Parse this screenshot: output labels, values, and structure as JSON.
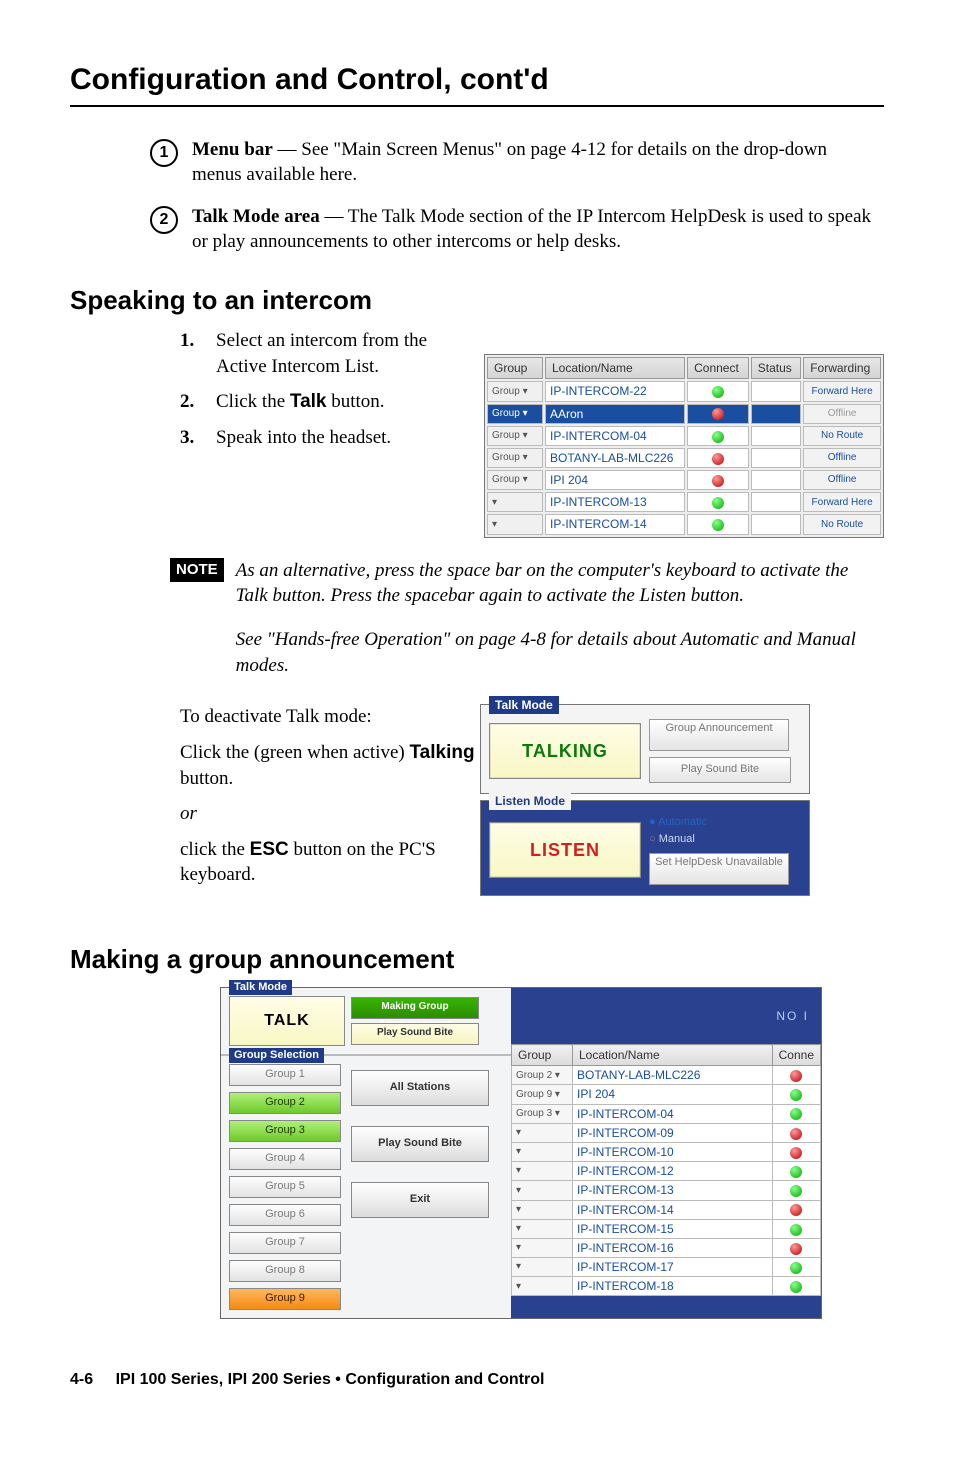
{
  "title": "Configuration and Control, cont'd",
  "items": [
    {
      "label": "1",
      "bold": "Menu bar",
      "text": " — See \"Main Screen Menus\" on page 4-12 for details on the drop-down menus available here."
    },
    {
      "label": "2",
      "bold": "Talk Mode area",
      "text": " — The Talk Mode section of the IP Intercom HelpDesk is used to speak or play announcements to other intercoms or help desks."
    }
  ],
  "speaking_heading": "Speaking to an intercom",
  "steps": [
    {
      "n": "1.",
      "t": "Select an intercom from the Active Intercom List."
    },
    {
      "n": "2.",
      "pre": "Click the ",
      "bold": "Talk",
      "post": " button."
    },
    {
      "n": "3.",
      "t": "Speak into the headset."
    }
  ],
  "mini_headers": [
    "Group",
    "Location/Name",
    "Connect",
    "Status",
    "Forwarding"
  ],
  "mini_rows": [
    {
      "g": "Group ▾",
      "name": "IP-INTERCOM-22",
      "dot": "green",
      "fwd": "Forward Here"
    },
    {
      "g": "Group ▾",
      "name": "AAron",
      "dot": "red",
      "fwd": "Offline",
      "sel": true
    },
    {
      "g": "Group ▾",
      "name": "IP-INTERCOM-04",
      "dot": "green",
      "fwd": "No Route"
    },
    {
      "g": "Group ▾",
      "name": "BOTANY-LAB-MLC226",
      "dot": "red",
      "fwd": "Offline"
    },
    {
      "g": "Group ▾",
      "name": "IPI 204",
      "dot": "red",
      "fwd": "Offline"
    },
    {
      "g": "▾",
      "name": "IP-INTERCOM-13",
      "dot": "green",
      "fwd": "Forward Here"
    },
    {
      "g": "▾",
      "name": "IP-INTERCOM-14",
      "dot": "green",
      "fwd": "No Route"
    }
  ],
  "note_label": "NOTE",
  "note_p1": "As an alternative, press the space bar on the computer's keyboard to activate the Talk button.  Press the spacebar again to activate the Listen button.",
  "note_p2": "See \"Hands-free Operation\" on page 4-8 for details about Automatic and Manual modes.",
  "deact": "To deactivate Talk mode:",
  "deact2_pre": "Click the (green when active) ",
  "deact2_bold": "Talking",
  "deact2_post": " button.",
  "or": "or",
  "deact3_pre": "click the ",
  "deact3_bold": "ESC",
  "deact3_post": " button on the PC'S keyboard.",
  "tl": {
    "talk_legend": "Talk Mode",
    "talking": "TALKING",
    "group_ann": "Group Announcement",
    "play_sb": "Play Sound Bite",
    "listen_legend": "Listen Mode",
    "listen": "LISTEN",
    "auto": "Automatic",
    "manual": "Manual",
    "set_unavail": "Set HelpDesk Unavailable"
  },
  "ga_heading": "Making a group announcement",
  "ga": {
    "talk_legend": "Talk Mode",
    "talk": "TALK",
    "making": "Making Group Announcement",
    "play_sb": "Play Sound Bite",
    "gs_legend": "Group Selection",
    "groups": [
      "Group 1",
      "Group 2",
      "Group 3",
      "Group 4",
      "Group 5",
      "Group 6",
      "Group 7",
      "Group 8",
      "Group 9"
    ],
    "all_stations": "All Stations",
    "play_sb2": "Play Sound Bite",
    "exit": "Exit",
    "no": "NO I",
    "ic_headers": [
      "Group",
      "Location/Name",
      "Conne"
    ],
    "ic_rows": [
      {
        "g": "Group 2 ▾",
        "name": "BOTANY-LAB-MLC226",
        "dot": "red"
      },
      {
        "g": "Group 9 ▾",
        "name": "IPI 204",
        "dot": "green"
      },
      {
        "g": "Group 3 ▾",
        "name": "IP-INTERCOM-04",
        "dot": "green"
      },
      {
        "g": "▾",
        "name": "IP-INTERCOM-09",
        "dot": "red"
      },
      {
        "g": "▾",
        "name": "IP-INTERCOM-10",
        "dot": "red"
      },
      {
        "g": "▾",
        "name": "IP-INTERCOM-12",
        "dot": "green"
      },
      {
        "g": "▾",
        "name": "IP-INTERCOM-13",
        "dot": "green"
      },
      {
        "g": "▾",
        "name": "IP-INTERCOM-14",
        "dot": "red"
      },
      {
        "g": "▾",
        "name": "IP-INTERCOM-15",
        "dot": "green"
      },
      {
        "g": "▾",
        "name": "IP-INTERCOM-16",
        "dot": "red"
      },
      {
        "g": "▾",
        "name": "IP-INTERCOM-17",
        "dot": "green"
      },
      {
        "g": "▾",
        "name": "IP-INTERCOM-18",
        "dot": "green"
      }
    ]
  },
  "footer_pg": "4-6",
  "footer_txt": "IPI 100 Series, IPI 200 Series • Configuration and Control"
}
